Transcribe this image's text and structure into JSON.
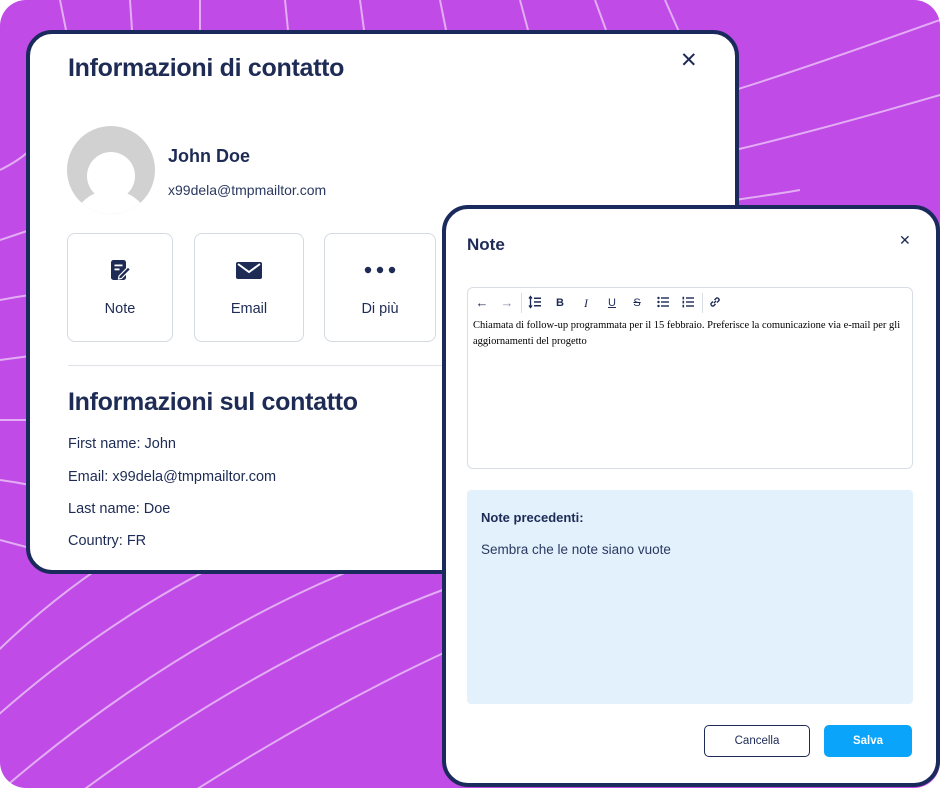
{
  "contact_card": {
    "title": "Informazioni di contatto",
    "close_symbol": "✕",
    "avatar_icon": "user-placeholder-icon",
    "name": "John Doe",
    "email": "x99dela@tmpmailtor.com",
    "actions": [
      {
        "label": "Note",
        "icon": "note-edit-icon"
      },
      {
        "label": "Email",
        "icon": "envelope-icon"
      },
      {
        "label": "Di più",
        "icon": "more-dots-icon"
      }
    ],
    "section_title": "Informazioni sul contatto",
    "info": [
      "First name: John",
      "Email: x99dela@tmpmailtor.com",
      "Last name: Doe",
      "Country: FR"
    ]
  },
  "note_modal": {
    "title": "Note",
    "close_symbol": "✕",
    "toolbar": [
      {
        "icon": "undo-icon",
        "glyph": "←"
      },
      {
        "icon": "redo-icon",
        "glyph": "→"
      },
      {
        "icon": "line-height-icon",
        "glyph": ""
      },
      {
        "icon": "bold-icon",
        "glyph": "B"
      },
      {
        "icon": "italic-icon",
        "glyph": "I"
      },
      {
        "icon": "underline-icon",
        "glyph": "U"
      },
      {
        "icon": "strikethrough-icon",
        "glyph": "S"
      },
      {
        "icon": "bullet-list-icon",
        "glyph": ""
      },
      {
        "icon": "numbered-list-icon",
        "glyph": ""
      },
      {
        "icon": "link-icon",
        "glyph": ""
      }
    ],
    "editor_text": "Chiamata di follow-up programmata per il 15 febbraio. Preferisce la comunicazione via e-mail per gli aggiornamenti del progetto",
    "previous_notes_title": "Note precedenti:",
    "previous_notes_empty": "Sembra che le note siano vuote",
    "cancel_label": "Cancella",
    "save_label": "Salva"
  },
  "colors": {
    "background": "#c04be6",
    "navy": "#1b2a5c",
    "accent": "#0aa4fa",
    "notes_panel": "#e3f1fd"
  }
}
